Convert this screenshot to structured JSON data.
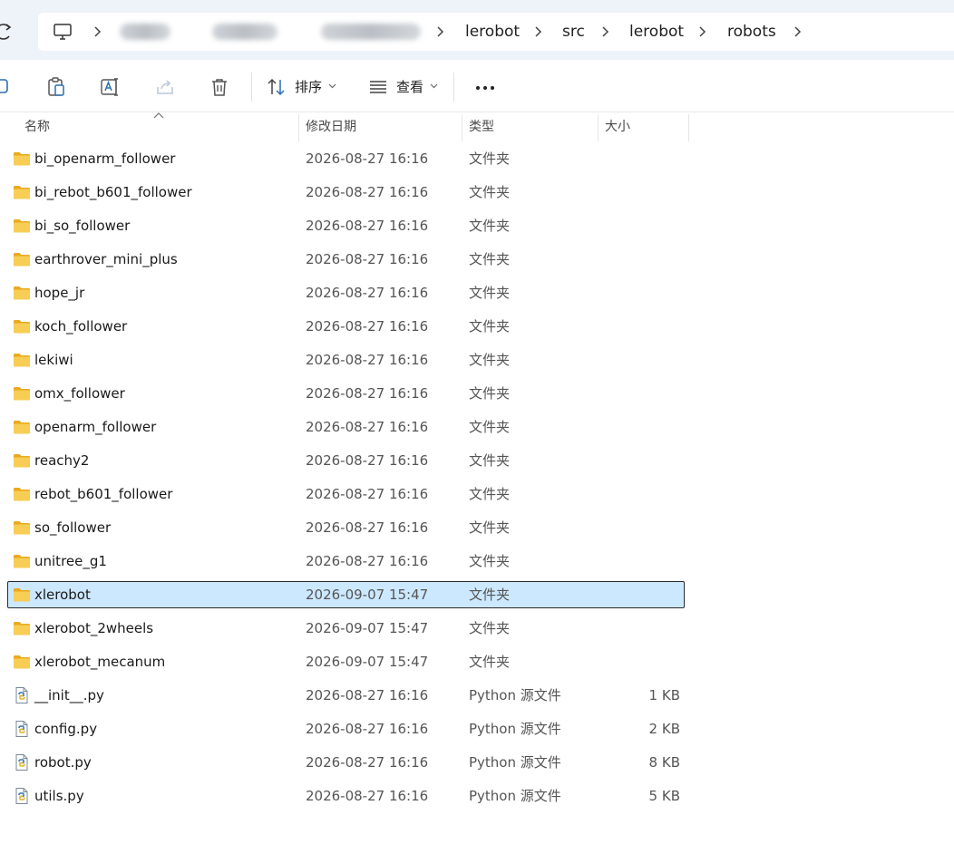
{
  "breadcrumb": {
    "items": [
      "lerobot",
      "src",
      "lerobot",
      "robots"
    ]
  },
  "toolbar": {
    "sort_label": "排序",
    "view_label": "查看"
  },
  "columns": {
    "name": "名称",
    "modified": "修改日期",
    "type": "类型",
    "size": "大小"
  },
  "files": [
    {
      "name": "bi_openarm_follower",
      "date": "2026-08-27 16:16",
      "type": "文件夹",
      "size": "",
      "kind": "folder"
    },
    {
      "name": "bi_rebot_b601_follower",
      "date": "2026-08-27 16:16",
      "type": "文件夹",
      "size": "",
      "kind": "folder"
    },
    {
      "name": "bi_so_follower",
      "date": "2026-08-27 16:16",
      "type": "文件夹",
      "size": "",
      "kind": "folder"
    },
    {
      "name": "earthrover_mini_plus",
      "date": "2026-08-27 16:16",
      "type": "文件夹",
      "size": "",
      "kind": "folder"
    },
    {
      "name": "hope_jr",
      "date": "2026-08-27 16:16",
      "type": "文件夹",
      "size": "",
      "kind": "folder"
    },
    {
      "name": "koch_follower",
      "date": "2026-08-27 16:16",
      "type": "文件夹",
      "size": "",
      "kind": "folder"
    },
    {
      "name": "lekiwi",
      "date": "2026-08-27 16:16",
      "type": "文件夹",
      "size": "",
      "kind": "folder"
    },
    {
      "name": "omx_follower",
      "date": "2026-08-27 16:16",
      "type": "文件夹",
      "size": "",
      "kind": "folder"
    },
    {
      "name": "openarm_follower",
      "date": "2026-08-27 16:16",
      "type": "文件夹",
      "size": "",
      "kind": "folder"
    },
    {
      "name": "reachy2",
      "date": "2026-08-27 16:16",
      "type": "文件夹",
      "size": "",
      "kind": "folder"
    },
    {
      "name": "rebot_b601_follower",
      "date": "2026-08-27 16:16",
      "type": "文件夹",
      "size": "",
      "kind": "folder"
    },
    {
      "name": "so_follower",
      "date": "2026-08-27 16:16",
      "type": "文件夹",
      "size": "",
      "kind": "folder"
    },
    {
      "name": "unitree_g1",
      "date": "2026-08-27 16:16",
      "type": "文件夹",
      "size": "",
      "kind": "folder"
    },
    {
      "name": "xlerobot",
      "date": "2026-09-07 15:47",
      "type": "文件夹",
      "size": "",
      "kind": "folder",
      "selected": true
    },
    {
      "name": "xlerobot_2wheels",
      "date": "2026-09-07 15:47",
      "type": "文件夹",
      "size": "",
      "kind": "folder"
    },
    {
      "name": "xlerobot_mecanum",
      "date": "2026-09-07 15:47",
      "type": "文件夹",
      "size": "",
      "kind": "folder"
    },
    {
      "name": "__init__.py",
      "date": "2026-08-27 16:16",
      "type": "Python 源文件",
      "size": "1 KB",
      "kind": "python"
    },
    {
      "name": "config.py",
      "date": "2026-08-27 16:16",
      "type": "Python 源文件",
      "size": "2 KB",
      "kind": "python"
    },
    {
      "name": "robot.py",
      "date": "2026-08-27 16:16",
      "type": "Python 源文件",
      "size": "8 KB",
      "kind": "python"
    },
    {
      "name": "utils.py",
      "date": "2026-08-27 16:16",
      "type": "Python 源文件",
      "size": "5 KB",
      "kind": "python"
    }
  ],
  "colors": {
    "selection": "#cce8ff",
    "folder": "#f4c54a",
    "python": "#3a78b5"
  }
}
